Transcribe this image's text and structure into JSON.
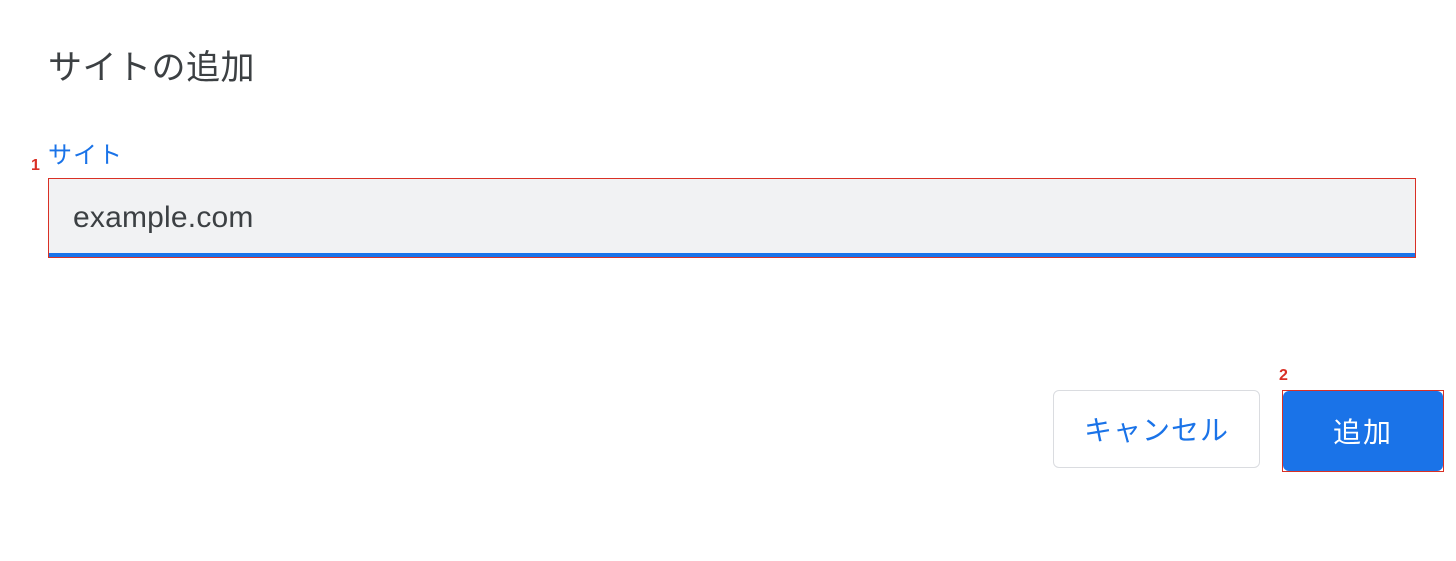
{
  "dialog": {
    "title": "サイトの追加",
    "field_label": "サイト",
    "site_value": "example.com",
    "site_placeholder": ""
  },
  "buttons": {
    "cancel": "キャンセル",
    "add": "追加"
  },
  "annotations": {
    "marker1": "1",
    "marker2": "2"
  },
  "colors": {
    "accent": "#1a73e8",
    "annotation": "#d93025",
    "input_bg": "#f1f2f3",
    "text": "#3c4043",
    "border": "#dadce0"
  }
}
